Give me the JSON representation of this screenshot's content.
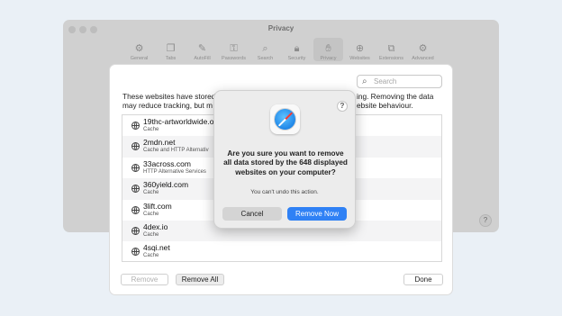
{
  "preferences": {
    "title": "Privacy",
    "toolbar": [
      {
        "label": "General",
        "icon": "⚙"
      },
      {
        "label": "Tabs",
        "icon": "❐"
      },
      {
        "label": "AutoFill",
        "icon": "✎"
      },
      {
        "label": "Passwords",
        "icon": "⚿"
      },
      {
        "label": "Search",
        "icon": "⌕"
      },
      {
        "label": "Security",
        "icon": "🔒︎"
      },
      {
        "label": "Privacy",
        "icon": "✋︎"
      },
      {
        "label": "Websites",
        "icon": "⊕"
      },
      {
        "label": "Extensions",
        "icon": "⧉"
      },
      {
        "label": "Advanced",
        "icon": "⚙"
      }
    ],
    "help": "?"
  },
  "website_data": {
    "search_placeholder": "Search",
    "description_line1_left": "These websites have stored",
    "description_line1_right": "ing. Removing the data",
    "description_line2_left": "may reduce tracking, but m",
    "description_line2_right": "ebsite behaviour.",
    "sites": [
      {
        "name": "19thc-artworldwide.o",
        "detail": "Cache"
      },
      {
        "name": "2mdn.net",
        "detail": "Cache and HTTP Alternativ"
      },
      {
        "name": "33across.com",
        "detail": "HTTP Alternative Services"
      },
      {
        "name": "360yield.com",
        "detail": "Cache"
      },
      {
        "name": "3lift.com",
        "detail": "Cache"
      },
      {
        "name": "4dex.io",
        "detail": "Cache"
      },
      {
        "name": "4sqi.net",
        "detail": "Cache"
      }
    ],
    "remove_label": "Remove",
    "remove_all_label": "Remove All",
    "done_label": "Done"
  },
  "dialog": {
    "help": "?",
    "message": "Are you sure you want to remove all data stored by the 648 displayed websites on your computer?",
    "info": "You can't undo this action.",
    "cancel_label": "Cancel",
    "confirm_label": "Remove Now"
  },
  "colors": {
    "accent": "#2f81f5"
  }
}
